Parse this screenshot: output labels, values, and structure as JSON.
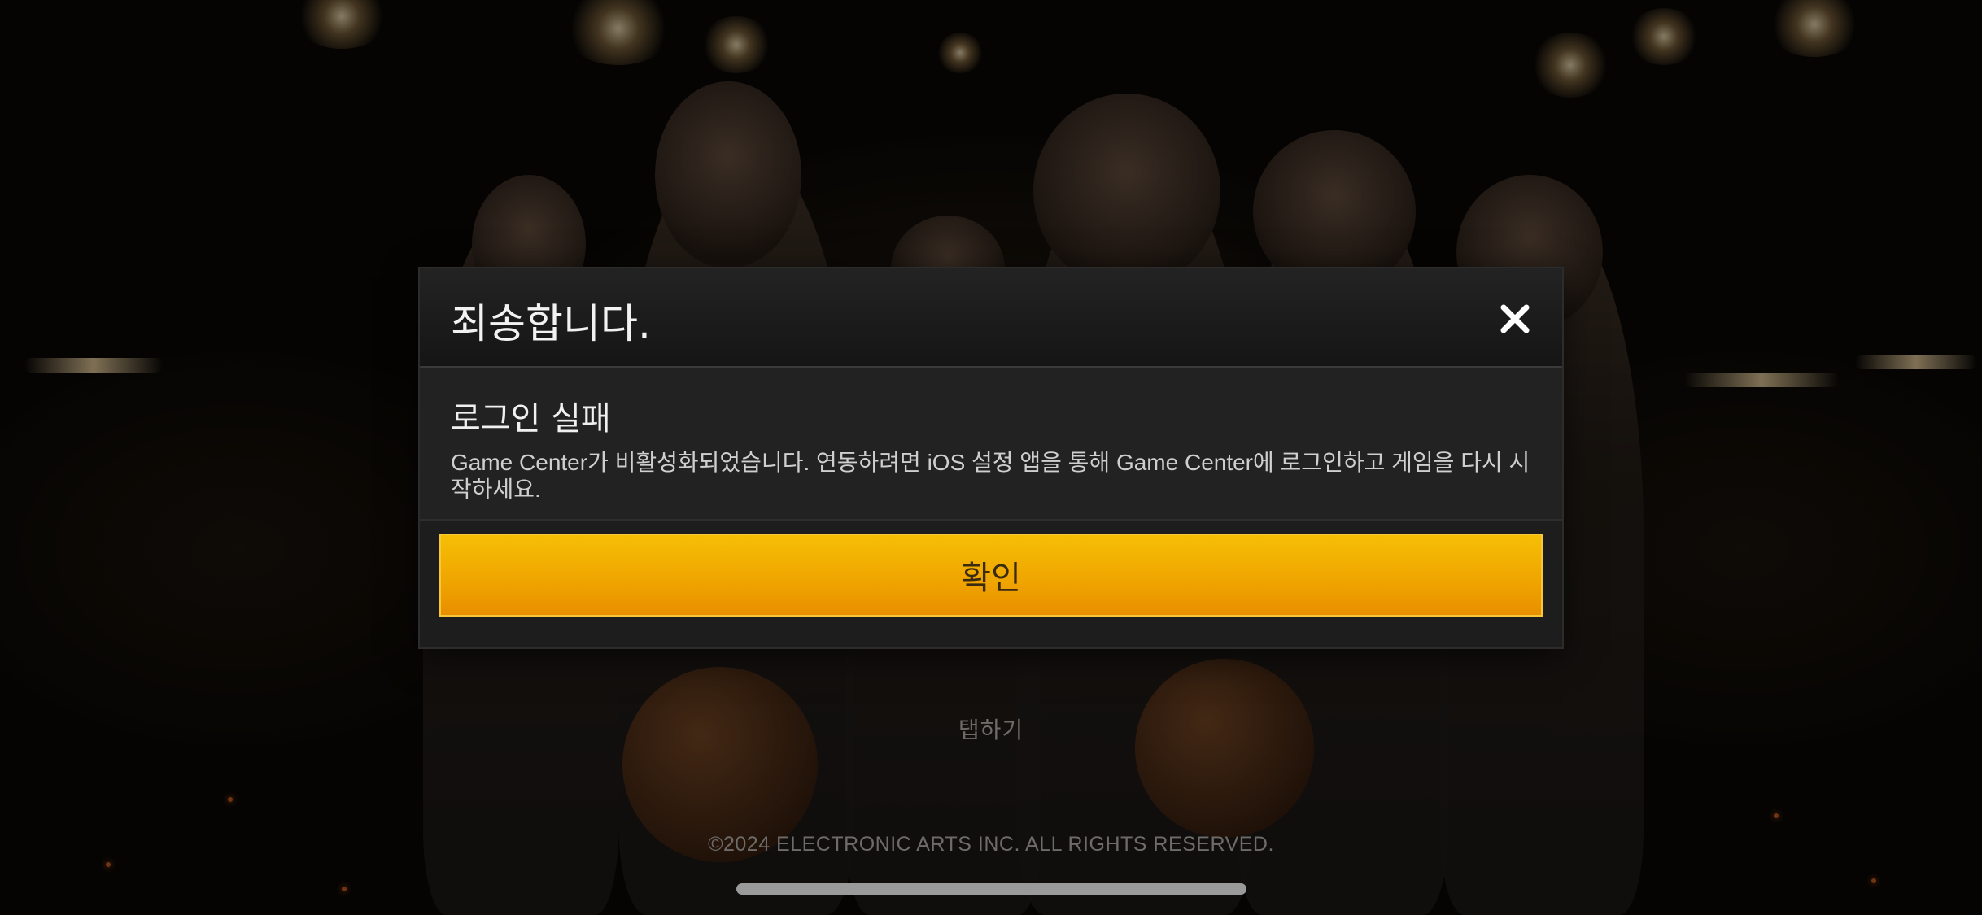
{
  "dialog": {
    "title": "죄송합니다.",
    "message_title": "로그인 실패",
    "message_text": "Game Center가 비활성화되었습니다. 연동하려면 iOS 설정 앱을 통해 Game Center에 로그인하고 게임을 다시 시작하세요.",
    "confirm_label": "확인",
    "close_icon": "close-icon"
  },
  "screen": {
    "tap_label": "탭하기",
    "copyright": "©2024 ELECTRONIC ARTS INC. ALL RIGHTS RESERVED."
  },
  "colors": {
    "confirm_button": "#f0a600",
    "dialog_background": "#1e1e1f",
    "title_text": "#f2f2f2"
  }
}
